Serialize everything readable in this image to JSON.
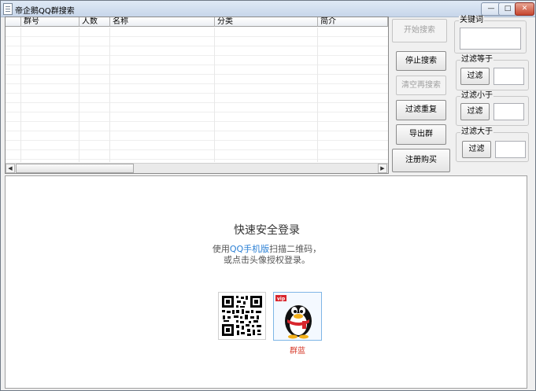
{
  "window": {
    "title": "帝企鹅QQ群搜索",
    "controls": {
      "minimize": "—",
      "maximize": "□",
      "close": "✕"
    }
  },
  "grid": {
    "columns": [
      "群号",
      "人数",
      "名称",
      "分类",
      "简介"
    ],
    "rows": []
  },
  "buttons": {
    "start_search": "开始搜索",
    "stop_search": "停止搜索",
    "clear_research": "清空再搜索",
    "filter_duplicates": "过滤重复",
    "export_groups": "导出群",
    "register_buy": "注册购买"
  },
  "button_states": {
    "start_search": "disabled",
    "clear_research": "disabled"
  },
  "keyword": {
    "label": "关键词",
    "value": ""
  },
  "filters": [
    {
      "label": "过滤等于",
      "button": "过滤",
      "value": ""
    },
    {
      "label": "过滤小于",
      "button": "过滤",
      "value": ""
    },
    {
      "label": "过滤大于",
      "button": "过滤",
      "value": ""
    }
  ],
  "login": {
    "title": "快速安全登录",
    "hint_prefix": "使用",
    "hint_link": "QQ手机版",
    "hint_suffix": "扫描二维码，",
    "hint_line2": "或点击头像授权登录。",
    "avatar_name": "群蓝",
    "avatar_badge": "vip"
  },
  "icons": {
    "app": "app-document-icon",
    "qr": "qr-code-icon",
    "avatar": "qq-penguin-avatar"
  },
  "colors": {
    "link": "#2a7fd4",
    "avatar_name": "#d63a2a",
    "close_button": "#c6452e"
  }
}
